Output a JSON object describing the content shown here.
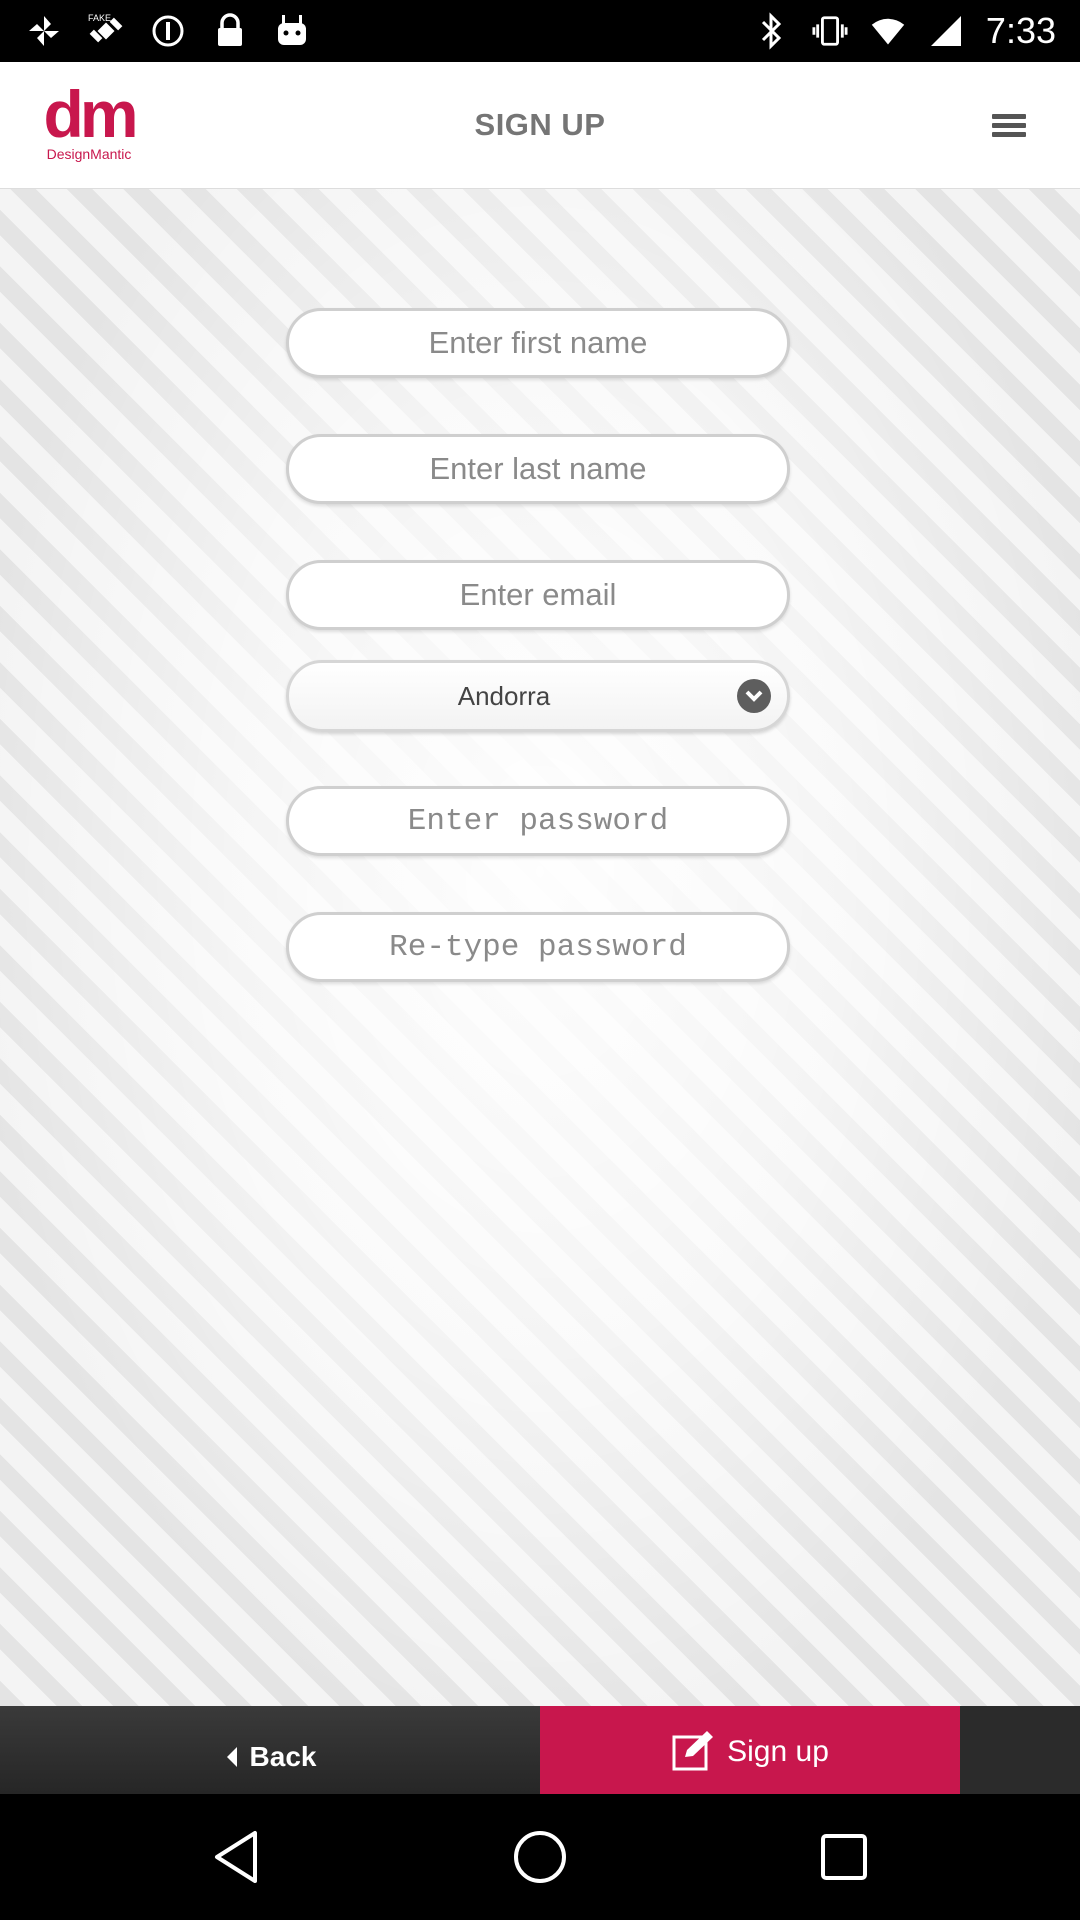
{
  "status_bar": {
    "time": "7:33",
    "left_icons": [
      "photos-icon",
      "fake-gps-icon",
      "alert-circle-icon",
      "lock-icon",
      "android-robot-icon"
    ],
    "right_icons": [
      "bluetooth-icon",
      "vibrate-icon",
      "wifi-icon",
      "signal-icon"
    ]
  },
  "header": {
    "logo_mark": "dm",
    "logo_text": "DesignMantic",
    "title": "SIGN UP"
  },
  "form": {
    "first_name": {
      "placeholder": "Enter first name",
      "value": ""
    },
    "last_name": {
      "placeholder": "Enter last name",
      "value": ""
    },
    "email": {
      "placeholder": "Enter email",
      "value": ""
    },
    "country": {
      "selected": "Andorra"
    },
    "password": {
      "placeholder": "Enter password",
      "value": ""
    },
    "retype_password": {
      "placeholder": "Re-type password",
      "value": ""
    }
  },
  "actions": {
    "back_label": "Back",
    "signup_label": "Sign up"
  },
  "colors": {
    "brand": "#c8174d",
    "title_gray": "#757575",
    "action_bar": "#2b2b2b"
  }
}
